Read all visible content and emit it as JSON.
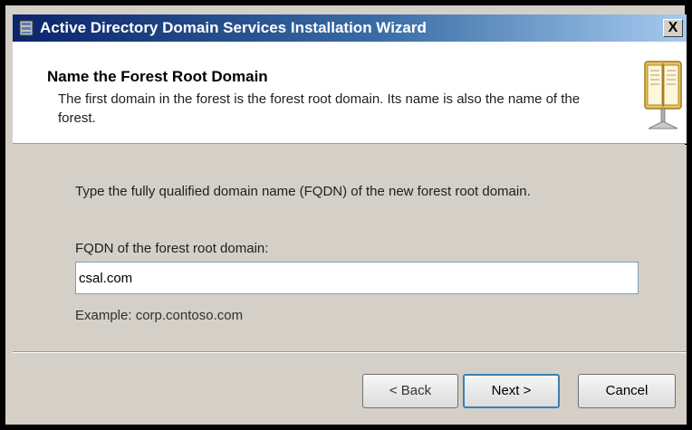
{
  "window": {
    "title": "Active Directory Domain Services Installation Wizard",
    "close_label": "X"
  },
  "header": {
    "title": "Name the Forest Root Domain",
    "description": "The first domain in the forest is the forest root domain. Its name is also the name of the forest.",
    "icon": "book-icon"
  },
  "body": {
    "instruction": "Type the fully qualified domain name (FQDN) of the new forest root domain.",
    "fqdn_label": "FQDN of the forest root domain:",
    "fqdn_value": "csal.com",
    "example": "Example: corp.contoso.com"
  },
  "footer": {
    "back_label": "< Back",
    "next_label": "Next >",
    "cancel_label": "Cancel"
  },
  "colors": {
    "titlebar_start": "#0a246a",
    "titlebar_end": "#a6caf0",
    "dialog_bg": "#d4d0c8",
    "default_button_border": "#3c7fb1"
  }
}
